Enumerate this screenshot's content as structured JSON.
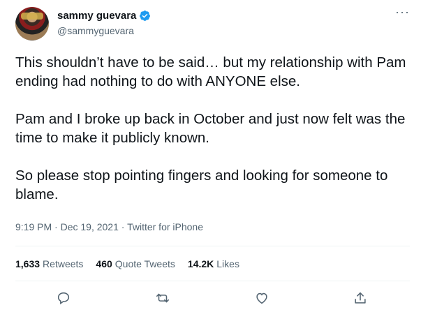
{
  "author": {
    "display_name": "sammy guevara",
    "handle": "@sammyguevara",
    "verified": true
  },
  "tweet": {
    "paragraphs": [
      "This shouldn’t have to be said… but my relationship with Pam ending had nothing to do with ANYONE else.",
      "Pam and I broke up back in October and just now felt was the time to make it publicly known.",
      "So please stop pointing fingers and looking for someone to blame."
    ],
    "time": "9:19 PM · Dec 19, 2021 · ",
    "source": "Twitter for iPhone"
  },
  "stats": {
    "retweets_count": "1,633",
    "retweets_label": "Retweets",
    "quotes_count": "460",
    "quotes_label": "Quote Tweets",
    "likes_count": "14.2K",
    "likes_label": "Likes"
  },
  "icons": {
    "more": "more-options-icon",
    "reply": "reply-icon",
    "retweet": "retweet-icon",
    "like": "heart-icon",
    "share": "share-icon"
  },
  "colors": {
    "verified": "#1d9bf0",
    "secondary_text": "#536471",
    "primary_text": "#0f1419",
    "divider": "#eff3f4"
  }
}
